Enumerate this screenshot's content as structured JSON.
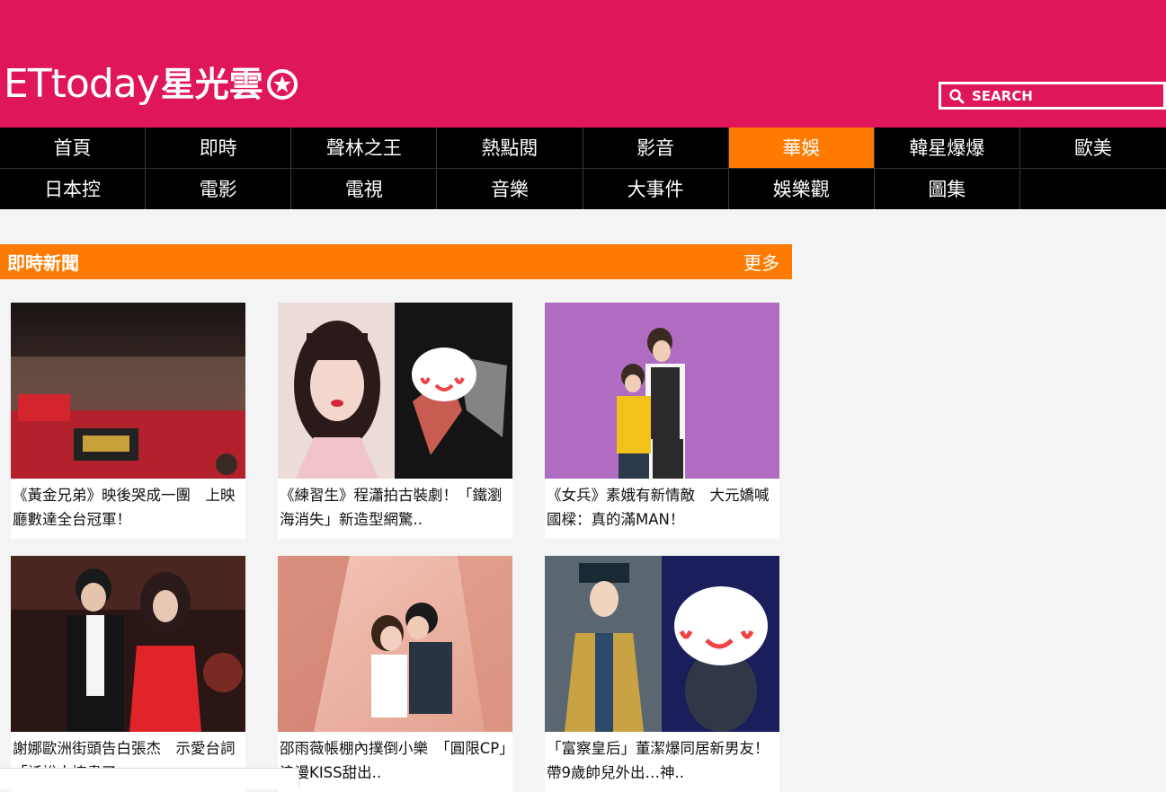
{
  "header": {
    "logo_brand": "ETtoday",
    "logo_cn": "星光雲",
    "search_placeholder": "SEARCH"
  },
  "nav": {
    "row1": [
      "首頁",
      "即時",
      "聲林之王",
      "熱點閱",
      "影音",
      "華娛",
      "韓星爆爆",
      "歐美"
    ],
    "row2": [
      "日本控",
      "電影",
      "電視",
      "音樂",
      "大事件",
      "娛樂觀",
      "圖集",
      ""
    ],
    "active": "華娛"
  },
  "section": {
    "title": "即時新聞",
    "more": "更多"
  },
  "cards": [
    {
      "caption": "《黃金兄弟》映後哭成一團　上映廳數達全台冠軍！"
    },
    {
      "caption": "《練習生》程瀟拍古裝劇！「鐵瀏海消失」新造型網驚.."
    },
    {
      "caption": "《女兵》素娥有新情敵　大元嬌喊國樑：真的滿MAN！"
    },
    {
      "caption": "謝娜歐洲街頭告白張杰　示愛台詞「話說太撩盡了」.."
    },
    {
      "caption": "邵雨薇帳棚內撲倒小樂　「圓限CP」浪漫KISS甜出.."
    },
    {
      "caption": "「富察皇后」董潔爆同居新男友！　帶9歲帥兒外出…神.."
    }
  ],
  "colors": {
    "header_bg": "#e0165a",
    "accent": "#ff7a00",
    "nav_bg": "#000000"
  }
}
